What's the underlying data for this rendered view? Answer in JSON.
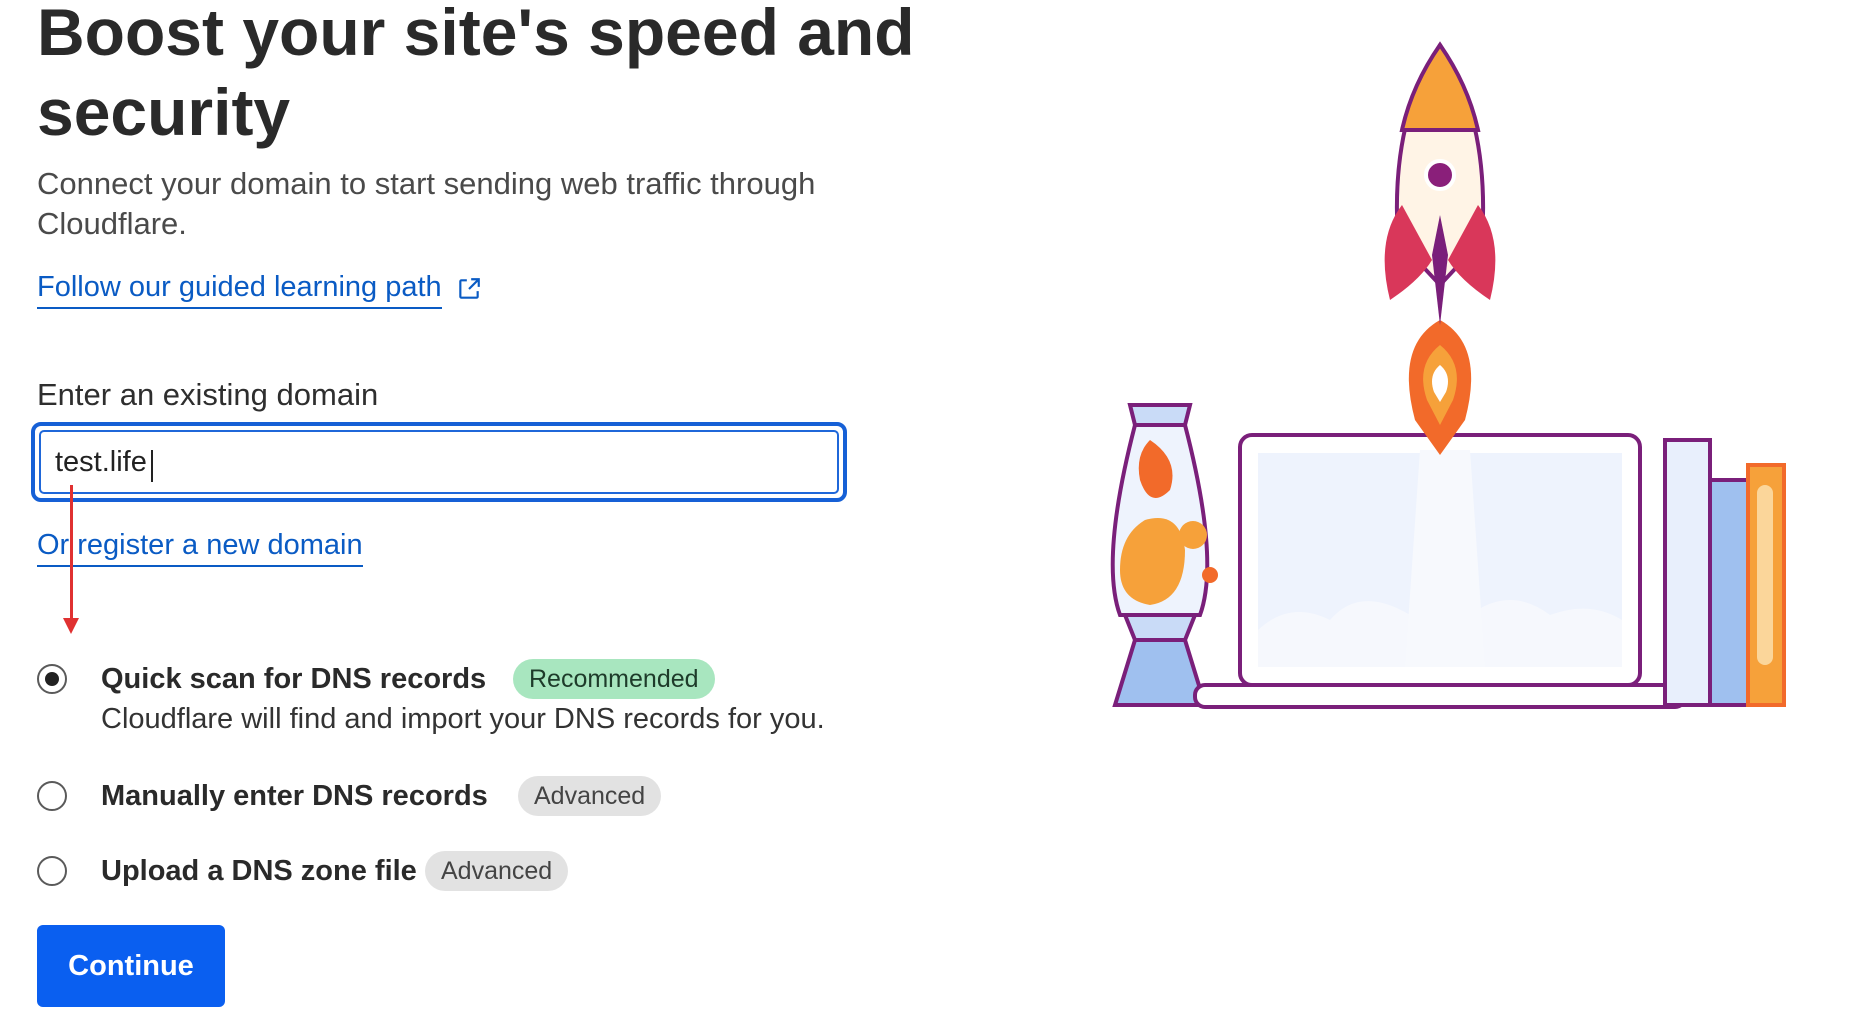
{
  "header": {
    "title": "Boost your site's speed and security",
    "subtitle": "Connect your domain to start sending web traffic through Cloudflare.",
    "learning_link": "Follow our guided learning path"
  },
  "domain_form": {
    "label": "Enter an existing domain",
    "value": "test.life",
    "register_link": "Or register a new domain"
  },
  "options": [
    {
      "title": "Quick scan for DNS records",
      "badge": "Recommended",
      "description": "Cloudflare will find and import your DNS records for you.",
      "selected": true
    },
    {
      "title": "Manually enter DNS records",
      "badge": "Advanced",
      "selected": false
    },
    {
      "title": "Upload a DNS zone file",
      "badge": "Advanced",
      "selected": false
    }
  ],
  "actions": {
    "continue_label": "Continue"
  },
  "icons": [
    "external-link-icon",
    "rocket-illustration",
    "laptop-illustration",
    "lava-lamp-illustration",
    "books-illustration"
  ],
  "colors": {
    "link": "#0a5bc4",
    "primary_button": "#0a5ff0",
    "input_focus": "#1660d6",
    "recommended_badge": "#a8e6bf",
    "advanced_badge": "#e2e2e2",
    "annotation_arrow": "#e03131"
  }
}
